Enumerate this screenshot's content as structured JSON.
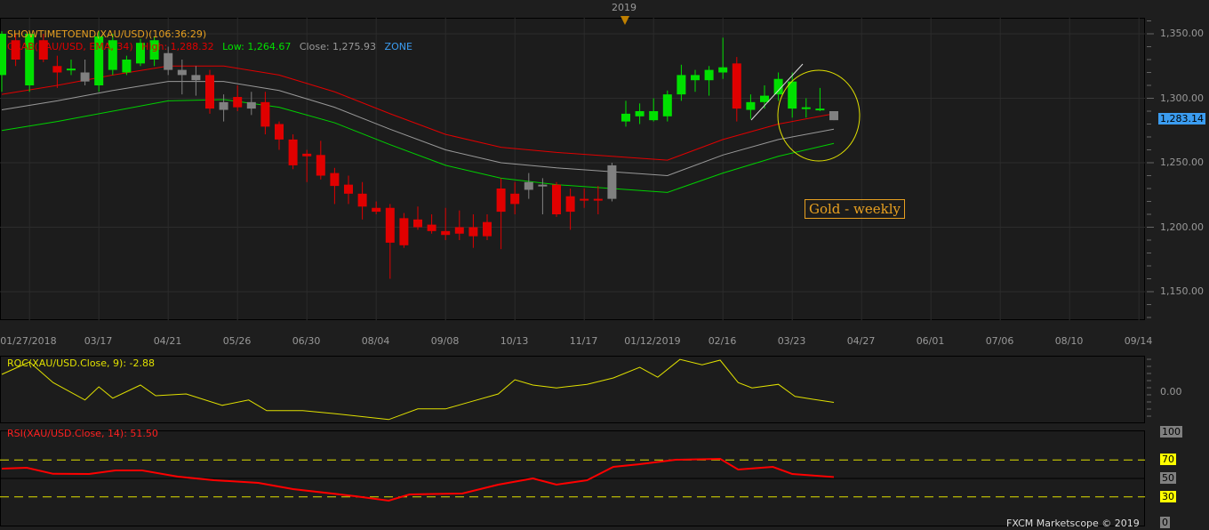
{
  "header": {
    "year_marker": "2019"
  },
  "main": {
    "title": "SHOWTIMETOEND(XAU/USD)(106:36:29)",
    "legend": {
      "grab": "GRAB(XAU/USD, EMA, 34)",
      "high": "High: 1,288.32",
      "low": "Low: 1,264.67",
      "close": "Close: 1,275.93",
      "zone": "ZONE"
    },
    "price_tag": "1,283.14",
    "annotation": "Gold - weekly",
    "footer": "FXCM Marketscope © 2019"
  },
  "chart_data": [
    {
      "type": "candlestick",
      "title": "XAU/USD weekly",
      "ylim": [
        1125,
        1365
      ],
      "yticks": [
        {
          "v": 1350,
          "l": "1,350.00"
        },
        {
          "v": 1300,
          "l": "1,300.00"
        },
        {
          "v": 1250,
          "l": "1,250.00"
        },
        {
          "v": 1200,
          "l": "1,200.00"
        },
        {
          "v": 1150,
          "l": "1,150.00"
        }
      ],
      "xticks": [
        {
          "i": 2,
          "l": "01/27/2018"
        },
        {
          "i": 7,
          "l": "03/17"
        },
        {
          "i": 12,
          "l": "04/21"
        },
        {
          "i": 17,
          "l": "05/26"
        },
        {
          "i": 22,
          "l": "06/30"
        },
        {
          "i": 27,
          "l": "08/04"
        },
        {
          "i": 32,
          "l": "09/08"
        },
        {
          "i": 37,
          "l": "10/13"
        },
        {
          "i": 42,
          "l": "11/17"
        },
        {
          "i": 47,
          "l": "01/12/2019"
        },
        {
          "i": 52,
          "l": "02/16"
        },
        {
          "i": 57,
          "l": "03/23"
        },
        {
          "i": 62,
          "l": "04/27"
        },
        {
          "i": 67,
          "l": "06/01"
        },
        {
          "i": 72,
          "l": "07/06"
        },
        {
          "i": 77,
          "l": "08/10"
        },
        {
          "i": 82,
          "l": "09/14"
        }
      ],
      "colors": {
        "up": "#00e000",
        "down": "#e00000",
        "neutral": "#808080"
      },
      "candles": [
        [
          1318,
          1352,
          1305,
          1350,
          "g"
        ],
        [
          1345,
          1350,
          1325,
          1330,
          "r"
        ],
        [
          1310,
          1352,
          1305,
          1350,
          "g"
        ],
        [
          1345,
          1350,
          1328,
          1330,
          "r"
        ],
        [
          1325,
          1333,
          1308,
          1320,
          "r"
        ],
        [
          1322,
          1330,
          1318,
          1323,
          "g"
        ],
        [
          1320,
          1330,
          1310,
          1313,
          "n"
        ],
        [
          1310,
          1352,
          1305,
          1348,
          "g"
        ],
        [
          1322,
          1350,
          1318,
          1345,
          "g"
        ],
        [
          1320,
          1333,
          1318,
          1330,
          "g"
        ],
        [
          1327,
          1346,
          1325,
          1343,
          "g"
        ],
        [
          1330,
          1348,
          1325,
          1345,
          "g"
        ],
        [
          1335,
          1340,
          1318,
          1322,
          "n"
        ],
        [
          1322,
          1330,
          1303,
          1318,
          "n"
        ],
        [
          1318,
          1325,
          1302,
          1314,
          "n"
        ],
        [
          1318,
          1322,
          1288,
          1292,
          "r"
        ],
        [
          1297,
          1303,
          1282,
          1291,
          "n"
        ],
        [
          1301,
          1310,
          1290,
          1293,
          "r"
        ],
        [
          1297,
          1305,
          1287,
          1292,
          "n"
        ],
        [
          1297,
          1305,
          1272,
          1278,
          "r"
        ],
        [
          1280,
          1282,
          1260,
          1268,
          "r"
        ],
        [
          1268,
          1272,
          1245,
          1248,
          "r"
        ],
        [
          1257,
          1260,
          1235,
          1255,
          "r"
        ],
        [
          1256,
          1267,
          1237,
          1240,
          "r"
        ],
        [
          1242,
          1246,
          1218,
          1232,
          "r"
        ],
        [
          1233,
          1240,
          1218,
          1226,
          "r"
        ],
        [
          1226,
          1235,
          1206,
          1216,
          "r"
        ],
        [
          1215,
          1220,
          1210,
          1212,
          "r"
        ],
        [
          1215,
          1218,
          1160,
          1188,
          "r"
        ],
        [
          1207,
          1211,
          1184,
          1186,
          "r"
        ],
        [
          1206,
          1216,
          1198,
          1200,
          "r"
        ],
        [
          1202,
          1210,
          1195,
          1197,
          "r"
        ],
        [
          1197,
          1215,
          1190,
          1194,
          "r"
        ],
        [
          1200,
          1213,
          1190,
          1195,
          "r"
        ],
        [
          1200,
          1210,
          1184,
          1193,
          "r"
        ],
        [
          1204,
          1210,
          1190,
          1193,
          "r"
        ],
        [
          1230,
          1238,
          1183,
          1212,
          "r"
        ],
        [
          1226,
          1235,
          1210,
          1218,
          "r"
        ],
        [
          1229,
          1242,
          1222,
          1235,
          "n"
        ],
        [
          1233,
          1238,
          1210,
          1233,
          "n"
        ],
        [
          1233,
          1235,
          1208,
          1210,
          "r"
        ],
        [
          1224,
          1230,
          1198,
          1212,
          "r"
        ],
        [
          1222,
          1230,
          1215,
          1222,
          "r"
        ],
        [
          1222,
          1232,
          1210,
          1222,
          "r"
        ],
        [
          1222,
          1250,
          1220,
          1248,
          "n"
        ],
        [
          1282,
          1298,
          1278,
          1288,
          "g"
        ],
        [
          1286,
          1296,
          1280,
          1290,
          "g"
        ],
        [
          1283,
          1300,
          1282,
          1290,
          "g"
        ],
        [
          1286,
          1306,
          1282,
          1303,
          "g"
        ],
        [
          1303,
          1326,
          1298,
          1318,
          "g"
        ],
        [
          1314,
          1322,
          1305,
          1318,
          "g"
        ],
        [
          1314,
          1325,
          1302,
          1322,
          "g"
        ],
        [
          1320,
          1347,
          1315,
          1324,
          "g"
        ],
        [
          1327,
          1332,
          1282,
          1292,
          "r"
        ],
        [
          1291,
          1303,
          1284,
          1297,
          "g"
        ],
        [
          1297,
          1310,
          1292,
          1302,
          "g"
        ],
        [
          1303,
          1320,
          1298,
          1315,
          "g"
        ],
        [
          1292,
          1320,
          1285,
          1313,
          "g"
        ],
        [
          1292,
          1300,
          1285,
          1293,
          "g"
        ],
        [
          1291,
          1308,
          1290,
          1292,
          "g"
        ],
        [
          1290,
          1290,
          1283,
          1283,
          "n"
        ]
      ],
      "ema_bands": {
        "step": 4,
        "upper": {
          "color": "#e00000",
          "values": [
            1303,
            1310,
            1318,
            1325,
            1325,
            1318,
            1305,
            1288,
            1272,
            1262,
            1258,
            1255,
            1252,
            1268,
            1280,
            1288
          ]
        },
        "middle": {
          "color": "#999999",
          "values": [
            1291,
            1298,
            1306,
            1313,
            1313,
            1306,
            1293,
            1276,
            1260,
            1250,
            1246,
            1243,
            1240,
            1256,
            1268,
            1276
          ]
        },
        "lower": {
          "color": "#00d000",
          "values": [
            1275,
            1282,
            1290,
            1298,
            1299,
            1293,
            1281,
            1264,
            1248,
            1238,
            1233,
            1230,
            1227,
            1242,
            1255,
            1265
          ]
        }
      }
    },
    {
      "type": "line",
      "title": "ROC(XAU/USD.Close, 9): -2.88",
      "ylim": [
        -9,
        10
      ],
      "yticks": [
        {
          "v": 0,
          "l": "0.00"
        }
      ],
      "color": "#e0e000",
      "points": [
        [
          0,
          5
        ],
        [
          2,
          8.5
        ],
        [
          3.7,
          2.7
        ],
        [
          6,
          -2.2
        ],
        [
          7,
          1.5
        ],
        [
          8,
          -1.7
        ],
        [
          10,
          2
        ],
        [
          11.1,
          -1
        ],
        [
          13.3,
          -0.5
        ],
        [
          15.9,
          -3.7
        ],
        [
          17.8,
          -2.2
        ],
        [
          19.1,
          -5.2
        ],
        [
          21.7,
          -5.2
        ],
        [
          23.9,
          -6
        ],
        [
          27.9,
          -7.7
        ],
        [
          30,
          -4.7
        ],
        [
          32,
          -4.7
        ],
        [
          33.8,
          -2.7
        ],
        [
          35.8,
          -0.5
        ],
        [
          37,
          3.5
        ],
        [
          38.3,
          2
        ],
        [
          40,
          1.2
        ],
        [
          42.2,
          2.2
        ],
        [
          44.1,
          4
        ],
        [
          46,
          7
        ],
        [
          47.3,
          4.2
        ],
        [
          48.9,
          9.2
        ],
        [
          50.5,
          7.7
        ],
        [
          51.8,
          9
        ],
        [
          53.1,
          2.7
        ],
        [
          54.1,
          1.2
        ],
        [
          56,
          2.2
        ],
        [
          57.2,
          -1.2
        ],
        [
          58.5,
          -2
        ],
        [
          60,
          -2.88
        ]
      ]
    },
    {
      "type": "line",
      "title": "RSI(XAU/USD.Close, 14): 51.50",
      "ylim": [
        0,
        100
      ],
      "color": "#ff0000",
      "yticks": [
        {
          "v": 100,
          "l": "100",
          "bg": "#808080"
        },
        {
          "v": 70,
          "l": "70",
          "bg": "#ffff00"
        },
        {
          "v": 50,
          "l": "50",
          "bg": "#808080"
        },
        {
          "v": 30,
          "l": "30",
          "bg": "#ffff00"
        },
        {
          "v": 0,
          "l": "0",
          "bg": "#808080"
        }
      ],
      "levels": [
        70,
        30
      ],
      "points": [
        [
          0,
          60.6
        ],
        [
          1.8,
          61.5
        ],
        [
          3.7,
          55
        ],
        [
          6.3,
          54.8
        ],
        [
          8.2,
          58.7
        ],
        [
          10.1,
          58.7
        ],
        [
          12.7,
          51.9
        ],
        [
          15.3,
          48.1
        ],
        [
          18.5,
          45.2
        ],
        [
          21,
          38.5
        ],
        [
          25.5,
          30.8
        ],
        [
          27.9,
          26
        ],
        [
          29.4,
          32.7
        ],
        [
          33.2,
          33.7
        ],
        [
          35.8,
          43.3
        ],
        [
          38.3,
          50
        ],
        [
          40,
          43.3
        ],
        [
          42.2,
          48
        ],
        [
          44.1,
          62.5
        ],
        [
          46,
          65.4
        ],
        [
          48.6,
          70.2
        ],
        [
          51.8,
          71.2
        ],
        [
          53.1,
          59.6
        ],
        [
          55.6,
          62.5
        ],
        [
          57,
          54.8
        ],
        [
          60,
          51.5
        ]
      ]
    }
  ]
}
